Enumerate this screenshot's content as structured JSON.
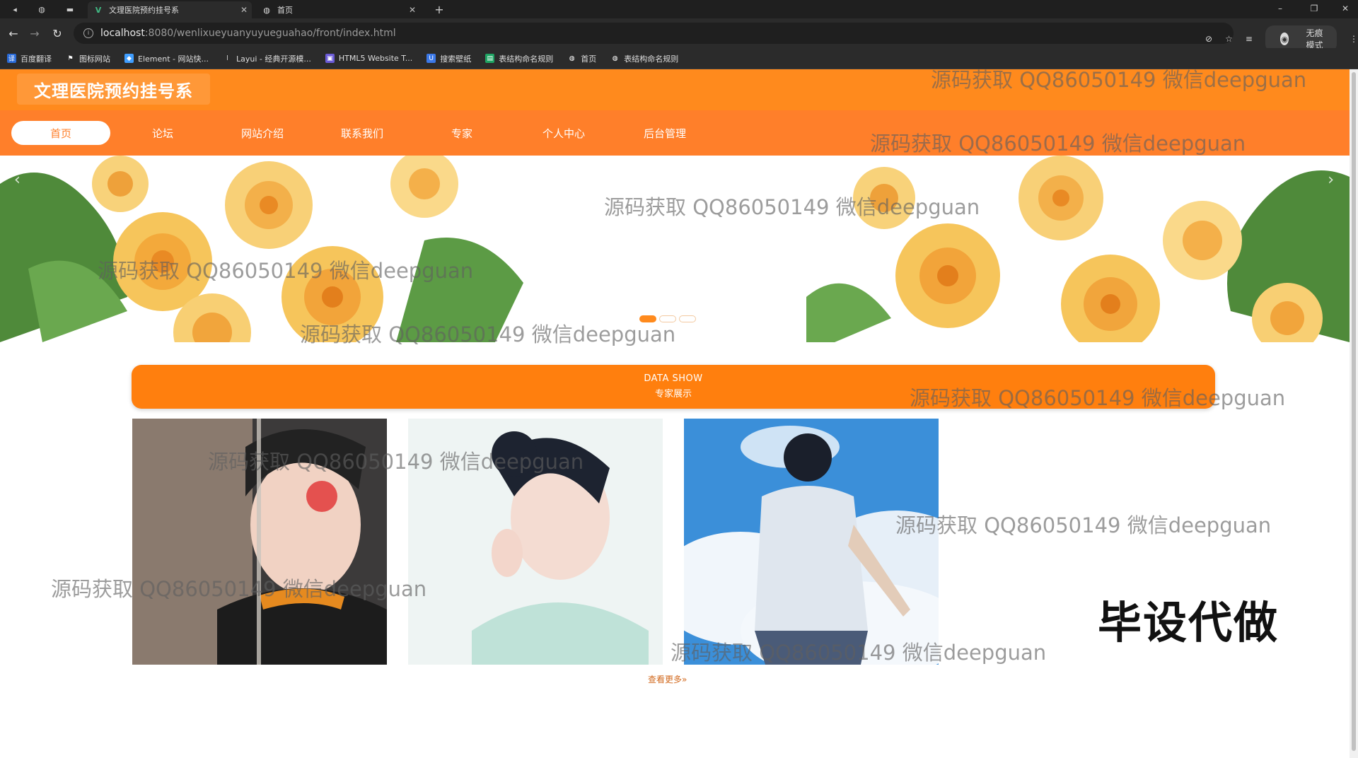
{
  "browser": {
    "tabs": [
      {
        "title": "文理医院预约挂号系",
        "active": true
      },
      {
        "title": "首页",
        "active": false
      }
    ],
    "url_host": "localhost",
    "url_path": ":8080/wenlixueyuanyuyueguahao/front/index.html",
    "profile_label": "无痕模式",
    "bookmarks": [
      "百度翻译",
      "图标网站",
      "Element - 网站快...",
      "Layui - 经典开源模...",
      "HTML5 Website T...",
      "搜索壁纸",
      "表结构命名规则",
      "首页",
      "表结构命名规则"
    ]
  },
  "site": {
    "title": "文理医院预约挂号系",
    "nav": [
      "首页",
      "论坛",
      "网站介绍",
      "联系我们",
      "专家",
      "个人中心",
      "后台管理"
    ],
    "active_nav_index": 0,
    "section": {
      "title_en": "DATA SHOW",
      "title_cn": "专家展示"
    },
    "more_link": "查看更多",
    "carousel": {
      "slide_count": 3,
      "active_index": 0
    },
    "accent_color": "#ff7f2a"
  },
  "overlay": {
    "watermark_text": "源码获取 QQ86050149 微信deepguan",
    "big_text": "毕设代做"
  }
}
